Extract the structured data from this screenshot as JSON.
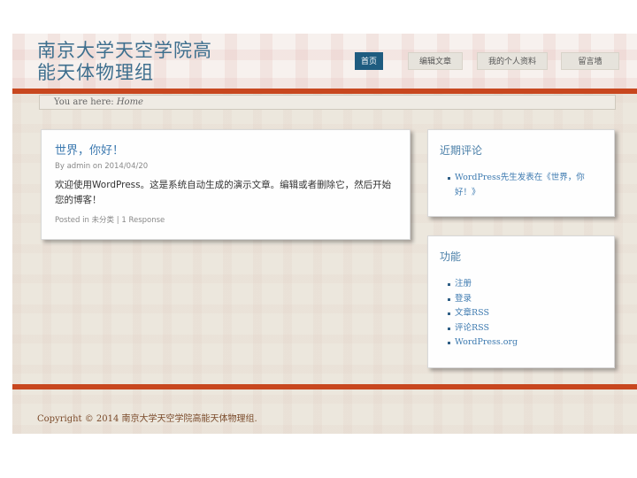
{
  "header": {
    "site_title": "南京大学天空学院高\n能天体物理组",
    "nav": [
      {
        "label": "首页",
        "active": true
      },
      {
        "label": "编辑文章"
      },
      {
        "label": "我的个人资料"
      },
      {
        "label": "留言墙"
      }
    ]
  },
  "breadcrumb": {
    "prefix": "You are here:",
    "current": "Home"
  },
  "post": {
    "title": "世界，你好！",
    "meta": "By admin on 2014/04/20",
    "body": "欢迎使用WordPress。这是系统自动生成的演示文章。编辑或者删除它，然后开始您的博客！",
    "footer": "Posted in 未分类 | 1 Response"
  },
  "widgets": {
    "recent_comments": {
      "title": "近期评论",
      "items": [
        "WordPress先生发表在《世界，你好！》"
      ]
    },
    "meta": {
      "title": "功能",
      "items": [
        "注册",
        "登录",
        "文章RSS",
        "评论RSS",
        "WordPress.org"
      ]
    }
  },
  "footer": {
    "text": "Copyright © 2014 南京大学天空学院高能天体物理组."
  },
  "colors": {
    "accent_rule": "#c8471f",
    "nav_active": "#1f5c80",
    "link": "#3d7ab0",
    "title": "#3e6f8e"
  }
}
